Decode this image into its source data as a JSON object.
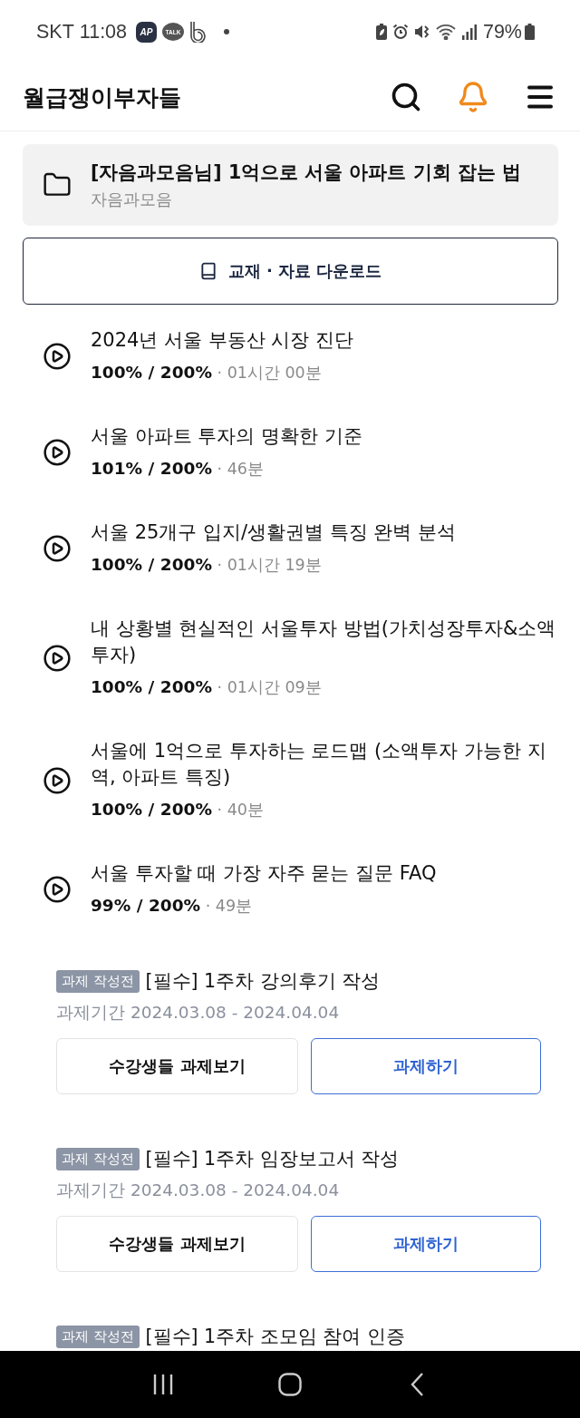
{
  "status_bar": {
    "carrier": "SKT",
    "time": "11:08",
    "notification_apps": [
      {
        "kind": "badge",
        "label": "AP"
      },
      {
        "kind": "bubble",
        "label": "TALK"
      },
      {
        "kind": "logo"
      }
    ],
    "battery_text": "79%"
  },
  "header": {
    "logo": "월급쟁이부자들",
    "notifications_unread": true
  },
  "course": {
    "title": "[자음과모음님] 1억으로 서울 아파트 기회 잡는 법",
    "author": "자음과모음"
  },
  "download_button": {
    "label": "교재 · 자료 다운로드"
  },
  "lectures": [
    {
      "title": "2024년 서울 부동산 시장 진단",
      "meta": "**100% / 200%** · 01시간 00분"
    },
    {
      "title": "서울 아파트 투자의 명확한 기준",
      "meta": "**101% / 200%** · 46분"
    },
    {
      "title": "서울 25개구 입지/생활권별 특징 완벽 분석",
      "meta": "**100% / 200%** · 01시간 19분"
    },
    {
      "title": "내 상황별 현실적인 서울투자 방법(가치성장투자&소액투자)",
      "meta": "**100% / 200%** · 01시간 09분"
    },
    {
      "title": "서울에 1억으로 투자하는 로드맵 (소액투자 가능한 지역, 아파트 특징)",
      "meta": "**100% / 200%** · 40분"
    },
    {
      "title": "서울 투자할 때 가장 자주 묻는 질문 FAQ",
      "meta": "**99% / 200%** · 49분"
    }
  ],
  "assignments": [
    {
      "status": "과제 작성전",
      "title": "[필수] 1주차 강의후기 작성",
      "period": "과제기간 2024.03.08 - 2024.04.04",
      "buttons": [
        {
          "kind": "secondary",
          "label": "수강생들 과제보기"
        },
        {
          "kind": "primary",
          "label": "과제하기"
        }
      ]
    },
    {
      "status": "과제 작성전",
      "title": "[필수] 1주차 임장보고서 작성",
      "period": "과제기간 2024.03.08 - 2024.04.04",
      "buttons": [
        {
          "kind": "secondary",
          "label": "수강생들 과제보기"
        },
        {
          "kind": "primary",
          "label": "과제하기"
        }
      ]
    },
    {
      "status": "과제 작성전",
      "title": "[필수] 1주차 조모임 참여 인증"
    }
  ]
}
